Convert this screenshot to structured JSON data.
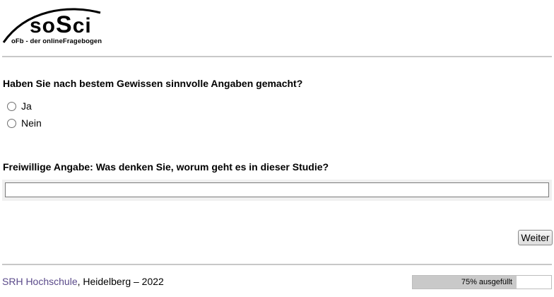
{
  "logo": {
    "wordmark_prefix": "so",
    "wordmark_big": "S",
    "wordmark_suffix": "ci",
    "tagline": "oFb - der onlineFragebogen"
  },
  "questions": [
    {
      "text": "Haben Sie nach bestem Gewissen sinnvolle Angaben gemacht?",
      "options": [
        "Ja",
        "Nein"
      ]
    },
    {
      "text": "Freiwillige Angabe: Was denken Sie, worum geht es in dieser Studie?",
      "input_value": ""
    }
  ],
  "navigation": {
    "next_label": "Weiter"
  },
  "footer": {
    "link_text": "SRH Hochschule",
    "rest_text": ", Heidelberg – 2022"
  },
  "progress": {
    "percent": 75,
    "label": "75% ausgefüllt"
  },
  "colors": {
    "link": "#5a4a8a",
    "separator": "#c8c8c8",
    "progress_fill": "#c9c9c9"
  }
}
